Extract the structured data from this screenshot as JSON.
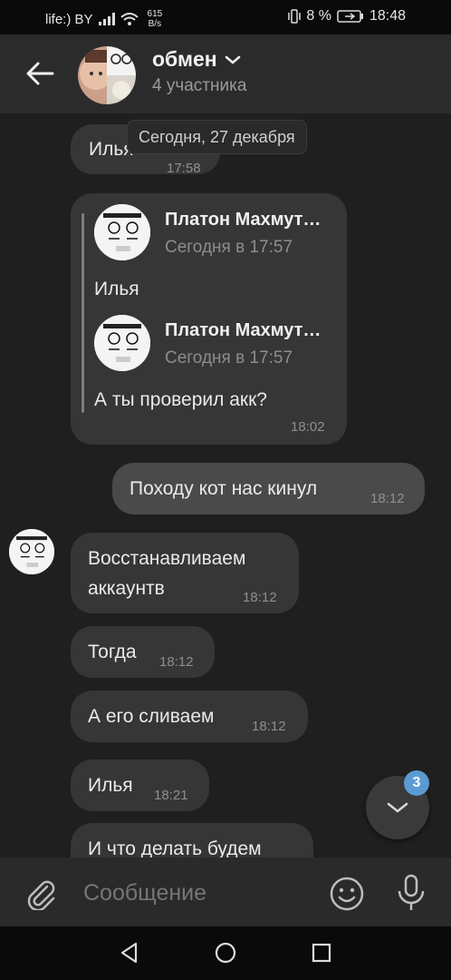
{
  "status_bar": {
    "carrier": "life:) BY",
    "net_speed_value": "615",
    "net_speed_unit": "B/s",
    "battery": "8 %",
    "time": "18:48"
  },
  "header": {
    "title": "обмен",
    "subtitle": "4 участника"
  },
  "chat": {
    "date_label": "Сегодня, 27 декабря",
    "first": {
      "text": "Илья",
      "time": "17:58"
    },
    "forwarded": {
      "items": [
        {
          "sender": "Платон Махмут…",
          "date": "Сегодня в 17:57",
          "text": "Илья"
        },
        {
          "sender": "Платон Махмут…",
          "date": "Сегодня в 17:57",
          "text": "А ты проверил акк?"
        }
      ],
      "time": "18:02"
    },
    "outgoing": {
      "text": "Походу кот нас кинул",
      "time": "18:12"
    },
    "incoming": [
      {
        "line1": "Восстанавливаем",
        "line2": "аккаунтв",
        "time": "18:12"
      },
      {
        "text": "Тогда",
        "time": "18:12"
      },
      {
        "text": "А его сливаем",
        "time": "18:12"
      },
      {
        "text": "Илья",
        "time": "18:21"
      },
      {
        "text": "И что делать будем"
      }
    ],
    "unread_count": "3"
  },
  "composer": {
    "placeholder": "Сообщение"
  },
  "colors": {
    "background": "#1f1f1f",
    "bubble": "#363636",
    "badge": "#5b9bd5"
  },
  "icons": [
    "back-arrow-icon",
    "chevron-down-icon",
    "paperclip-icon",
    "emoji-icon",
    "microphone-icon",
    "nav-back-icon",
    "nav-home-icon",
    "nav-recents-icon"
  ]
}
